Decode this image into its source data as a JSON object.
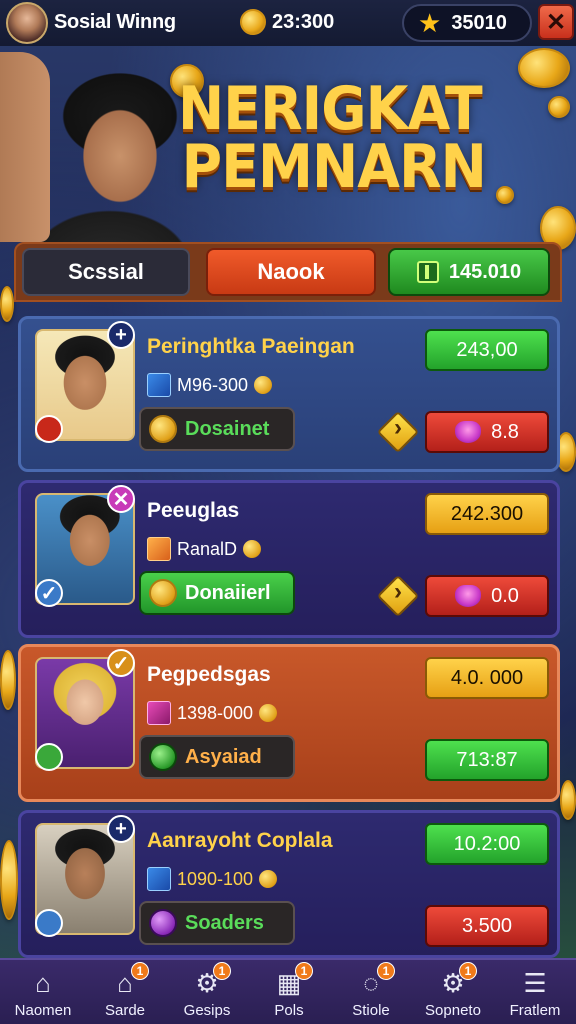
{
  "header": {
    "app_title": "Sosial Winng",
    "coins": "23:300",
    "stars": "35010"
  },
  "hero": {
    "title_line1": "NERIGKAT",
    "title_line2": "PEMNARN"
  },
  "tabs": [
    {
      "label": "Scssial"
    },
    {
      "label": "Naook"
    }
  ],
  "balance": "145.010",
  "cards": [
    {
      "name": "Peringhtka Paeingan",
      "sub": "M96-300",
      "action": "Dosainet",
      "top_value": "243,00",
      "bottom_value": "8.8"
    },
    {
      "name": "Peeuglas",
      "sub": "RanalD",
      "action": "Donaiierl",
      "top_value": "242.300",
      "bottom_value": "0.0"
    },
    {
      "name": "Pegpedsgas",
      "sub": "1398-000",
      "action": "Asyaiad",
      "top_value": "4.0. 000",
      "bottom_value": "713:87"
    },
    {
      "name": "Aanrayoht Coplala",
      "sub": "1090-100",
      "action": "Soaders",
      "top_value": "10.2:00",
      "bottom_value": "3.500"
    }
  ],
  "nav": [
    {
      "label": "Naomen",
      "icon": "home-icon",
      "badge": ""
    },
    {
      "label": "Sarde",
      "icon": "store-icon",
      "badge": "1"
    },
    {
      "label": "Gesips",
      "icon": "gear-icon",
      "badge": "1"
    },
    {
      "label": "Pols",
      "icon": "qr-icon",
      "badge": "1"
    },
    {
      "label": "Stiole",
      "icon": "chat-icon",
      "badge": "1"
    },
    {
      "label": "Sopneto",
      "icon": "settings-icon",
      "badge": "1"
    },
    {
      "label": "Fratlem",
      "icon": "menu-icon",
      "badge": ""
    }
  ],
  "colors": {
    "accent_orange": "#e8582a",
    "accent_green": "#2fb02f",
    "accent_gold": "#ffd24a",
    "accent_red": "#d02a1e"
  }
}
